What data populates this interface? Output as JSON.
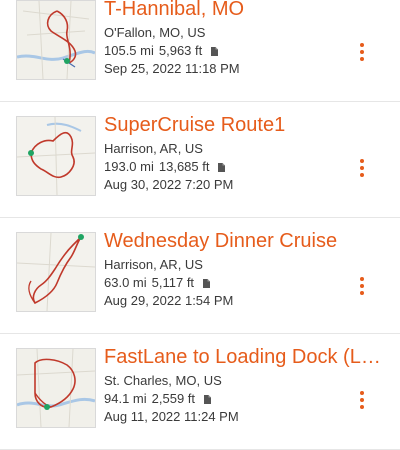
{
  "theme": {
    "accent": "#e65c1b",
    "text": "#3a3a3a",
    "divider": "#e6e6e6"
  },
  "routes": [
    {
      "title": "T-Hannibal, MO",
      "location": "O'Fallon, MO, US",
      "distance": "105.5 mi",
      "elevation": "5,963 ft",
      "date": "Sep 25, 2022 11:18 PM",
      "icons": {
        "file": "document-icon",
        "menu": "more-vertical-icon"
      }
    },
    {
      "title": "SuperCruise Route1",
      "location": "Harrison, AR, US",
      "distance": "193.0 mi",
      "elevation": "13,685 ft",
      "date": "Aug 30, 2022 7:20 PM",
      "icons": {
        "file": "document-icon",
        "menu": "more-vertical-icon"
      }
    },
    {
      "title": "Wednesday Dinner Cruise",
      "location": "Harrison, AR, US",
      "distance": "63.0 mi",
      "elevation": "5,117 ft",
      "date": "Aug 29, 2022 1:54 PM",
      "icons": {
        "file": "document-icon",
        "menu": "more-vertical-icon"
      }
    },
    {
      "title": "FastLane to Loading Dock (L…",
      "location": "St. Charles, MO, US",
      "distance": "94.1 mi",
      "elevation": "2,559 ft",
      "date": "Aug 11, 2022 11:24 PM",
      "icons": {
        "file": "document-icon",
        "menu": "more-vertical-icon"
      }
    }
  ]
}
